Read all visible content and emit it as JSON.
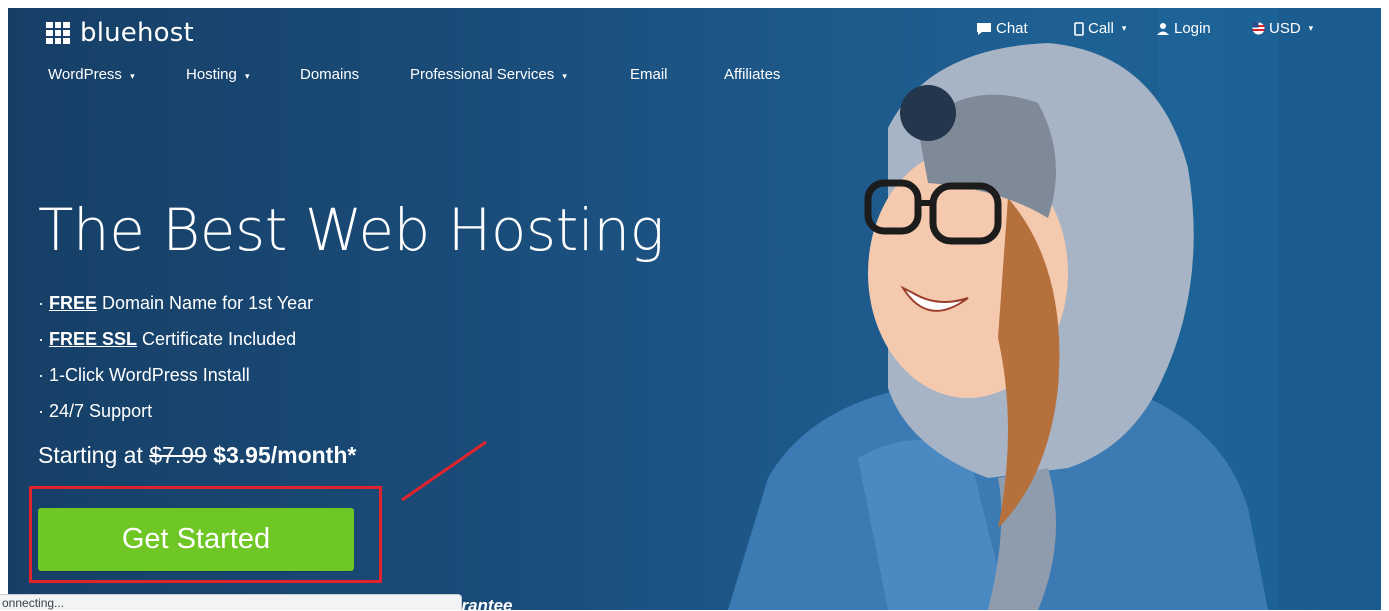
{
  "brand": {
    "name": "bluehost"
  },
  "utility_nav": {
    "chat": "Chat",
    "call": "Call",
    "login": "Login",
    "currency": "USD"
  },
  "main_nav": {
    "items": [
      {
        "label": "WordPress",
        "has_dropdown": true
      },
      {
        "label": "Hosting",
        "has_dropdown": true
      },
      {
        "label": "Domains",
        "has_dropdown": false
      },
      {
        "label": "Professional Services",
        "has_dropdown": true
      },
      {
        "label": "Email",
        "has_dropdown": false
      },
      {
        "label": "Affiliates",
        "has_dropdown": false
      }
    ]
  },
  "hero": {
    "headline": "The Best Web Hosting",
    "features": [
      {
        "bullet": "·",
        "emphasis": "FREE",
        "rest": " Domain Name for 1st Year"
      },
      {
        "bullet": "·",
        "emphasis": "FREE SSL",
        "rest": " Certificate Included"
      },
      {
        "bullet": "·",
        "emphasis": "",
        "rest": "1-Click WordPress Install"
      },
      {
        "bullet": "·",
        "emphasis": "",
        "rest": "24/7 Support"
      }
    ],
    "price_prefix": "Starting at ",
    "old_price": "$7.99",
    "new_price": "$3.95/month*",
    "cta_label": "Get Started",
    "guarantee_partial": "arantee"
  },
  "status_bar": {
    "text": "onnecting..."
  },
  "colors": {
    "hero_bg": "#1a4c79",
    "cta_green": "#6fc726",
    "annotation_red": "#e0232c",
    "text": "#ffffff"
  },
  "icons": {
    "chat": "chat-bubble-icon",
    "call": "phone-icon",
    "login": "user-icon",
    "currency": "us-flag-icon"
  }
}
